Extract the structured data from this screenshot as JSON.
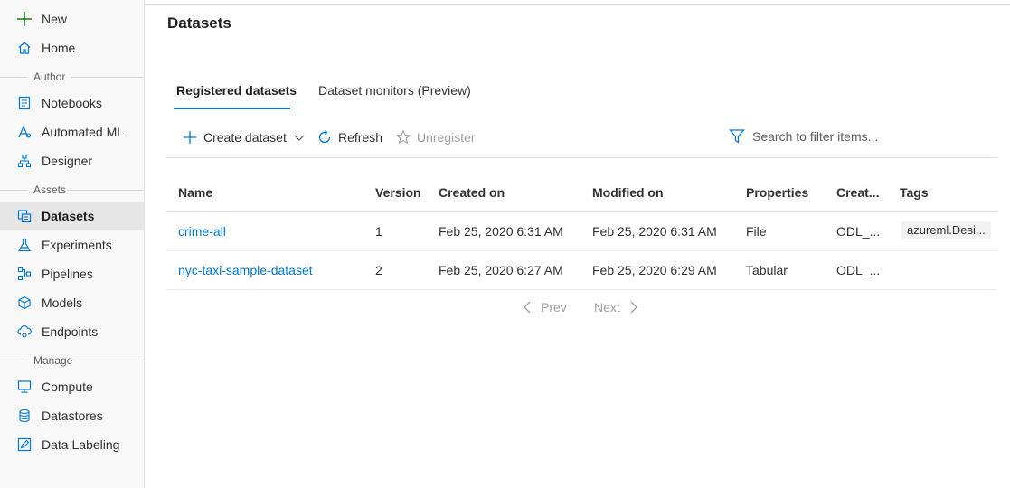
{
  "sidebar": {
    "new_label": "New",
    "home_label": "Home",
    "sections": {
      "author": "Author",
      "assets": "Assets",
      "manage": "Manage"
    },
    "author_items": [
      {
        "label": "Notebooks",
        "icon": "notebook-icon"
      },
      {
        "label": "Automated ML",
        "icon": "automated-ml-icon"
      },
      {
        "label": "Designer",
        "icon": "designer-icon"
      }
    ],
    "asset_items": [
      {
        "label": "Datasets",
        "icon": "datasets-icon",
        "active": true
      },
      {
        "label": "Experiments",
        "icon": "flask-icon"
      },
      {
        "label": "Pipelines",
        "icon": "pipeline-icon"
      },
      {
        "label": "Models",
        "icon": "models-icon"
      },
      {
        "label": "Endpoints",
        "icon": "endpoint-icon"
      }
    ],
    "manage_items": [
      {
        "label": "Compute",
        "icon": "monitor-icon"
      },
      {
        "label": "Datastores",
        "icon": "database-icon"
      },
      {
        "label": "Data Labeling",
        "icon": "labeling-icon"
      }
    ]
  },
  "page": {
    "title": "Datasets",
    "tabs": [
      {
        "label": "Registered datasets",
        "active": true
      },
      {
        "label": "Dataset monitors (Preview)",
        "active": false
      }
    ]
  },
  "toolbar": {
    "create_label": "Create dataset",
    "refresh_label": "Refresh",
    "unregister_label": "Unregister",
    "search_placeholder": "Search to filter items..."
  },
  "table": {
    "columns": [
      "Name",
      "Version",
      "Created on",
      "Modified on",
      "Properties",
      "Creat...",
      "Tags"
    ],
    "rows": [
      {
        "name": "crime-all",
        "version": "1",
        "created_on": "Feb 25, 2020 6:31 AM",
        "modified_on": "Feb 25, 2020 6:31 AM",
        "properties": "File",
        "created_by": "ODL_...",
        "tags": "azureml.Desi..."
      },
      {
        "name": "nyc-taxi-sample-dataset",
        "version": "2",
        "created_on": "Feb 25, 2020 6:27 AM",
        "modified_on": "Feb 25, 2020 6:29 AM",
        "properties": "Tabular",
        "created_by": "ODL_...",
        "tags": ""
      }
    ]
  },
  "pagination": {
    "prev_label": "Prev",
    "next_label": "Next"
  },
  "colors": {
    "accent": "#0078d4",
    "new_plus": "#107c10",
    "sidebar_bg": "#f8f8f8",
    "active_bg": "#e6e6e6"
  }
}
